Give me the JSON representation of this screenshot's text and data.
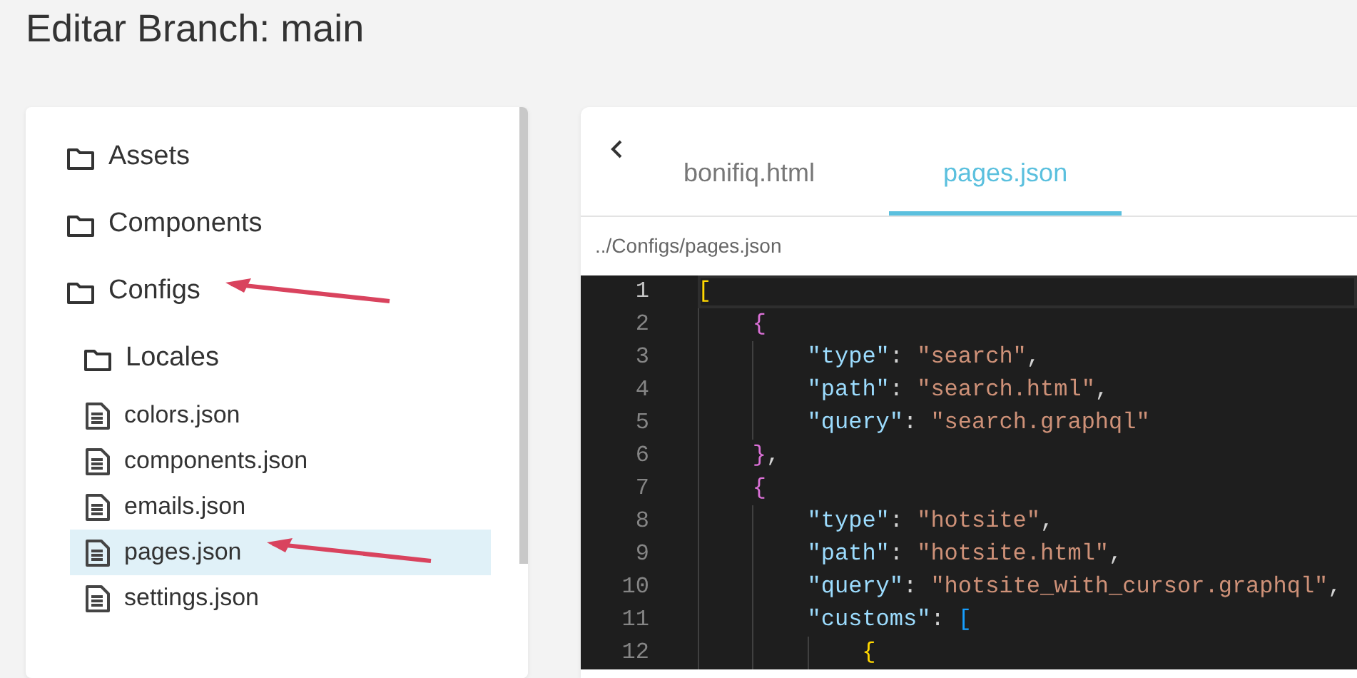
{
  "page_title": "Editar Branch: main",
  "file_tree": [
    {
      "kind": "folder",
      "label": "Assets",
      "selected": false,
      "annotated": false
    },
    {
      "kind": "folder",
      "label": "Components",
      "selected": false,
      "annotated": false
    },
    {
      "kind": "folder",
      "label": "Configs",
      "selected": false,
      "annotated": true,
      "children": [
        {
          "kind": "folder",
          "label": "Locales",
          "selected": false,
          "annotated": false
        },
        {
          "kind": "file",
          "label": "colors.json",
          "selected": false,
          "annotated": false
        },
        {
          "kind": "file",
          "label": "components.json",
          "selected": false,
          "annotated": false
        },
        {
          "kind": "file",
          "label": "emails.json",
          "selected": false,
          "annotated": false
        },
        {
          "kind": "file",
          "label": "pages.json",
          "selected": true,
          "annotated": true
        },
        {
          "kind": "file",
          "label": "settings.json",
          "selected": false,
          "annotated": false
        }
      ]
    }
  ],
  "editor": {
    "tabs": [
      {
        "label": "bonifiq.html",
        "selected": false
      },
      {
        "label": "pages.json",
        "selected": true
      }
    ],
    "file_path": "../Configs/pages.json",
    "lines": [
      {
        "number": "1",
        "current": true,
        "tokens": [
          {
            "kind": "bracket1",
            "text": "["
          }
        ]
      },
      {
        "number": "2",
        "current": false,
        "tokens": [
          {
            "kind": "indent"
          },
          {
            "kind": "bracket2",
            "text": "{"
          }
        ]
      },
      {
        "number": "3",
        "current": false,
        "tokens": [
          {
            "kind": "indent"
          },
          {
            "kind": "indent"
          },
          {
            "kind": "key",
            "text": "\"type\""
          },
          {
            "kind": "punct",
            "text": ": "
          },
          {
            "kind": "string",
            "text": "\"search\""
          },
          {
            "kind": "punct",
            "text": ","
          }
        ]
      },
      {
        "number": "4",
        "current": false,
        "tokens": [
          {
            "kind": "indent"
          },
          {
            "kind": "indent"
          },
          {
            "kind": "key",
            "text": "\"path\""
          },
          {
            "kind": "punct",
            "text": ": "
          },
          {
            "kind": "string",
            "text": "\"search.html\""
          },
          {
            "kind": "punct",
            "text": ","
          }
        ]
      },
      {
        "number": "5",
        "current": false,
        "tokens": [
          {
            "kind": "indent"
          },
          {
            "kind": "indent"
          },
          {
            "kind": "key",
            "text": "\"query\""
          },
          {
            "kind": "punct",
            "text": ": "
          },
          {
            "kind": "string",
            "text": "\"search.graphql\""
          }
        ]
      },
      {
        "number": "6",
        "current": false,
        "tokens": [
          {
            "kind": "indent"
          },
          {
            "kind": "bracket2",
            "text": "}"
          },
          {
            "kind": "punct",
            "text": ","
          }
        ]
      },
      {
        "number": "7",
        "current": false,
        "tokens": [
          {
            "kind": "indent"
          },
          {
            "kind": "bracket2",
            "text": "{"
          }
        ]
      },
      {
        "number": "8",
        "current": false,
        "tokens": [
          {
            "kind": "indent"
          },
          {
            "kind": "indent"
          },
          {
            "kind": "key",
            "text": "\"type\""
          },
          {
            "kind": "punct",
            "text": ": "
          },
          {
            "kind": "string",
            "text": "\"hotsite\""
          },
          {
            "kind": "punct",
            "text": ","
          }
        ]
      },
      {
        "number": "9",
        "current": false,
        "tokens": [
          {
            "kind": "indent"
          },
          {
            "kind": "indent"
          },
          {
            "kind": "key",
            "text": "\"path\""
          },
          {
            "kind": "punct",
            "text": ": "
          },
          {
            "kind": "string",
            "text": "\"hotsite.html\""
          },
          {
            "kind": "punct",
            "text": ","
          }
        ]
      },
      {
        "number": "10",
        "current": false,
        "tokens": [
          {
            "kind": "indent"
          },
          {
            "kind": "indent"
          },
          {
            "kind": "key",
            "text": "\"query\""
          },
          {
            "kind": "punct",
            "text": ": "
          },
          {
            "kind": "string",
            "text": "\"hotsite_with_cursor.graphql\""
          },
          {
            "kind": "punct",
            "text": ","
          }
        ]
      },
      {
        "number": "11",
        "current": false,
        "tokens": [
          {
            "kind": "indent"
          },
          {
            "kind": "indent"
          },
          {
            "kind": "key",
            "text": "\"customs\""
          },
          {
            "kind": "punct",
            "text": ": "
          },
          {
            "kind": "bracket3",
            "text": "["
          }
        ]
      },
      {
        "number": "12",
        "current": false,
        "tokens": [
          {
            "kind": "indent"
          },
          {
            "kind": "indent"
          },
          {
            "kind": "indent"
          },
          {
            "kind": "bracket1",
            "text": "{"
          }
        ]
      }
    ]
  }
}
